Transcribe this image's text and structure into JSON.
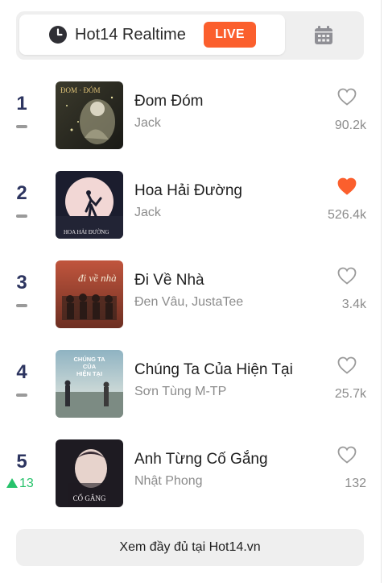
{
  "header": {
    "title": "Hot14 Realtime",
    "live_label": "LIVE",
    "accent_color": "#fb5f2d",
    "icons": {
      "clock": "clock-icon",
      "calendar": "calendar-icon"
    }
  },
  "songs": [
    {
      "rank": "1",
      "title": "Đom Đóm",
      "artist": "Jack",
      "likes": "90.2k",
      "liked": false,
      "trend": "flat",
      "trend_value": "",
      "cover_text": "ĐOM · ĐÓM"
    },
    {
      "rank": "2",
      "title": "Hoa Hải Đường",
      "artist": "Jack",
      "likes": "526.4k",
      "liked": true,
      "trend": "flat",
      "trend_value": "",
      "cover_text": "HOA HẢI ĐƯỜNG"
    },
    {
      "rank": "3",
      "title": "Đi Về Nhà",
      "artist": "Đen Vâu, JustaTee",
      "likes": "3.4k",
      "liked": false,
      "trend": "flat",
      "trend_value": "",
      "cover_text": "đi về nhà"
    },
    {
      "rank": "4",
      "title": "Chúng Ta Của Hiện Tại",
      "artist": "Sơn Tùng M-TP",
      "likes": "25.7k",
      "liked": false,
      "trend": "flat",
      "trend_value": "",
      "cover_text": "CHÚNG TA CỦA HIỆN TẠI"
    },
    {
      "rank": "5",
      "title": "Anh Từng Cố Gắng",
      "artist": "Nhật Phong",
      "likes": "132",
      "liked": false,
      "trend": "up",
      "trend_value": "13",
      "cover_text": "CỐ GẮNG"
    }
  ],
  "footer": {
    "label": "Xem đầy đủ tại Hot14.vn"
  }
}
